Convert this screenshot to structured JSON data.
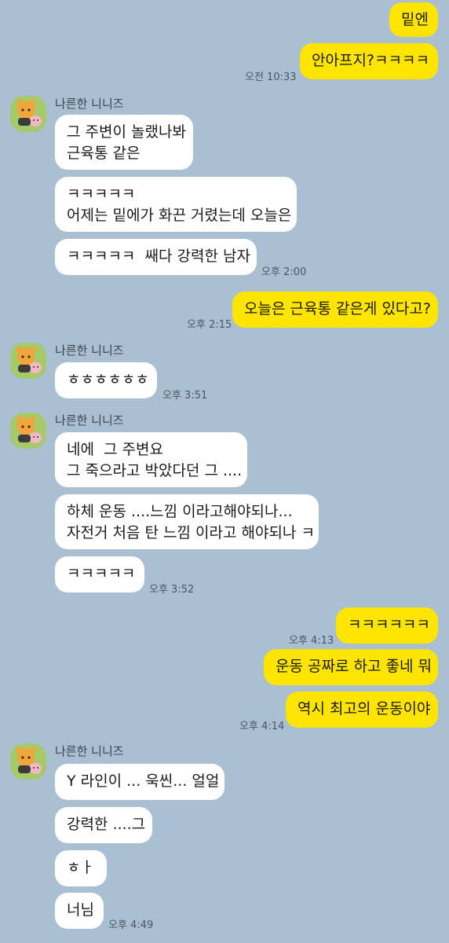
{
  "messages": {
    "m1": "밑엔",
    "m2": "안아프지?ㅋㅋㅋㅋ",
    "m2_time": "오전 10:33",
    "sender": "나른한 니니즈",
    "g1_a": "그 주변이 놀랬나봐\n근육통 같은",
    "g1_b": "ㅋㅋㅋㅋㅋ\n어제는 밑에가 화끈 거렸는데 오늘은",
    "g1_c": "ㅋㅋㅋㅋㅋ  쌔다 강력한 남자",
    "g1_time": "오후 2:00",
    "m3": "오늘은 근육통 같은게 있다고?",
    "m3_time": "오후 2:15",
    "g2_a": "ㅎㅎㅎㅎㅎㅎ",
    "g2_time": "오후 3:51",
    "g3_a": "네에  그 주변요\n그 죽으라고 박았다던 그 ....",
    "g3_b": "하체 운동 ....느낌 이라고해야되나...\n자전거 처음 탄 느낌 이라고 해야되나 ㅋ",
    "g3_c": "ㅋㅋㅋㅋㅋ",
    "g3_time": "오후 3:52",
    "m4": "ㅋㅋㅋㅋㅋㅋ",
    "m4_time": "오후 4:13",
    "m5": "운동 공짜로 하고 좋네 뭐",
    "m6": "역시 최고의 운동이야",
    "m6_time": "오후 4:14",
    "g4_a": "Y 라인이 ... 욱씬... 얼얼",
    "g4_b": "강력한 ....그",
    "g4_c": "ㅎㅏ",
    "g4_d": "너님",
    "g4_time": "오후 4:49"
  },
  "colors": {
    "background": "#aabfd1",
    "my_bubble": "#fee500",
    "their_bubble": "#ffffff"
  },
  "icons": {
    "avatar": "niniz-character-avatar"
  }
}
